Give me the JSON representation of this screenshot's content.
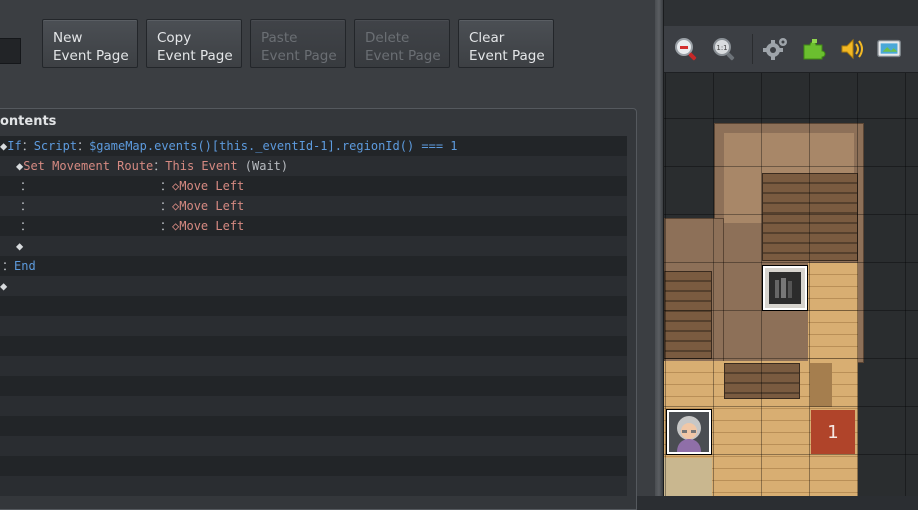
{
  "toolbar": {
    "new_page": [
      "New",
      "Event Page"
    ],
    "copy_page": [
      "Copy",
      "Event Page"
    ],
    "paste_page": [
      "Paste",
      "Event Page"
    ],
    "delete_page": [
      "Delete",
      "Event Page"
    ],
    "clear_page": [
      "Clear",
      "Event Page"
    ]
  },
  "contents": {
    "label": "ontents",
    "rows": [
      {
        "marker": "◆",
        "cmd": "If",
        "sep": "：",
        "arg1": "Script",
        "sep2": "：",
        "arg2": "$gameMap.events()[this._eventId-1].regionId() === 1"
      },
      {
        "marker": "◆",
        "cmd": "Set Movement Route",
        "sep": "：",
        "arg1": "This Event",
        "arg2": "(Wait)"
      },
      {
        "marker": "：",
        "sep": "：",
        "arg1": "◇Move Left"
      },
      {
        "marker": "：",
        "sep": "：",
        "arg1": "◇Move Left"
      },
      {
        "marker": "：",
        "sep": "：",
        "arg1": "◇Move Left"
      },
      {
        "marker": "◆"
      },
      {
        "marker": "：",
        "cmd": "End"
      },
      {
        "marker": "◆"
      }
    ]
  },
  "map_toolbar": {
    "icons": [
      "zoom-out-icon",
      "zoom-actual-size-icon",
      "settings-gear-icon",
      "plugin-puzzle-icon",
      "sound-speaker-icon",
      "playtest-icon"
    ],
    "zoom_actual_label": "1:1"
  },
  "map": {
    "region_label": "1",
    "colors": {
      "region": "#b0442a",
      "floor": "#d8ae72",
      "wall": "#8d7058"
    }
  }
}
